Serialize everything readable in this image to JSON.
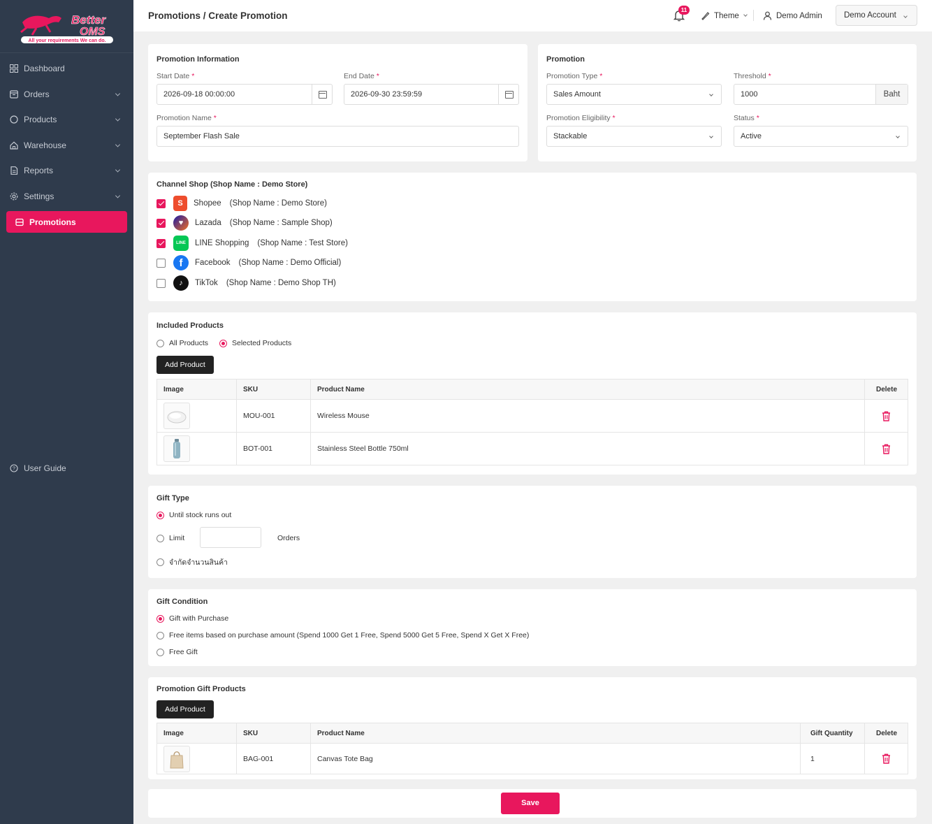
{
  "brand": {
    "name_line1": "Better",
    "name_line2": "OMS",
    "tagline": "All your requirements We can do.",
    "accent": "#e8175d"
  },
  "sidebar": {
    "items": [
      {
        "label": "Dashboard",
        "icon": "grid-icon",
        "has_chevron": false
      },
      {
        "label": "Orders",
        "icon": "box-icon",
        "has_chevron": true
      },
      {
        "label": "Products",
        "icon": "circle-icon",
        "has_chevron": true
      },
      {
        "label": "Warehouse",
        "icon": "home-icon",
        "has_chevron": true
      },
      {
        "label": "Reports",
        "icon": "document-icon",
        "has_chevron": true
      },
      {
        "label": "Settings",
        "icon": "gear-icon",
        "has_chevron": true
      },
      {
        "label": "Promotions",
        "icon": "tag-icon",
        "active": true
      }
    ],
    "user_guide": "User Guide"
  },
  "header": {
    "breadcrumb": "Promotions / Create Promotion",
    "notifications": "11",
    "theme": "Theme",
    "user": "Demo Admin",
    "account": "Demo Account"
  },
  "promo_info": {
    "title": "Promotion Information",
    "start_label": "Start Date",
    "start_value": "2026-09-18 00:00:00",
    "end_label": "End Date",
    "end_value": "2026-09-30 23:59:59",
    "name_label": "Promotion Name",
    "name_value": "September Flash Sale"
  },
  "promotion": {
    "title": "Promotion",
    "type_label": "Promotion Type",
    "type_value": "Sales Amount",
    "threshold_label": "Threshold",
    "threshold_value": "1000",
    "threshold_unit": "Baht",
    "eligibility_label": "Promotion Eligibility",
    "eligibility_value": "Stackable",
    "status_label": "Status",
    "status_value": "Active"
  },
  "channels": {
    "title": "Channel Shop (Shop Name : Demo Store)",
    "items": [
      {
        "name": "Shopee",
        "shop": "(Shop Name : Demo Store)",
        "checked": true,
        "color": "#ee4d2d",
        "glyph": "S"
      },
      {
        "name": "Lazada",
        "shop": "(Shop Name : Sample Shop)",
        "checked": true,
        "color": "#1a1aa6",
        "glyph": "♥"
      },
      {
        "name": "LINE Shopping",
        "shop": "(Shop Name : Test Store)",
        "checked": true,
        "color": "#06c755",
        "glyph": "LINE"
      },
      {
        "name": "Facebook",
        "shop": "(Shop Name : Demo Official)",
        "checked": false,
        "color": "#1877f2",
        "glyph": "f"
      },
      {
        "name": "TikTok",
        "shop": "(Shop Name  : Demo Shop TH)",
        "checked": false,
        "color": "#111111",
        "glyph": "♪"
      }
    ]
  },
  "included": {
    "title": "Included Products",
    "opt_all": "All Products",
    "opt_selected": "Selected Products",
    "add_btn": "Add Product",
    "cols": {
      "image": "Image",
      "sku": "SKU",
      "name": "Product Name",
      "delete": "Delete"
    },
    "rows": [
      {
        "sku": "MOU-001",
        "name": "Wireless Mouse",
        "thumb": "mouse"
      },
      {
        "sku": "BOT-001",
        "name": "Stainless Steel Bottle 750ml",
        "thumb": "bottle"
      }
    ]
  },
  "gift_type": {
    "title": "Gift Type",
    "opt1": "Until stock runs out",
    "opt2": "Limit",
    "opt2_unit": "Orders",
    "opt3": "จำกัดจำนวนสินค้า"
  },
  "gift_condition": {
    "title": "Gift Condition",
    "opt1": "Gift with Purchase",
    "opt2": "Free items based on purchase amount (Spend 1000 Get 1 Free, Spend 5000 Get 5 Free, Spend X Get X Free)",
    "opt3": "Free Gift"
  },
  "gift_products": {
    "title": "Promotion Gift Products",
    "add_btn": "Add Product",
    "cols": {
      "image": "Image",
      "sku": "SKU",
      "name": "Product Name",
      "qty": "Gift Quantity",
      "delete": "Delete"
    },
    "rows": [
      {
        "sku": "BAG-001",
        "name": "Canvas Tote Bag",
        "qty": "1",
        "thumb": "bag"
      }
    ]
  },
  "save_label": "Save"
}
